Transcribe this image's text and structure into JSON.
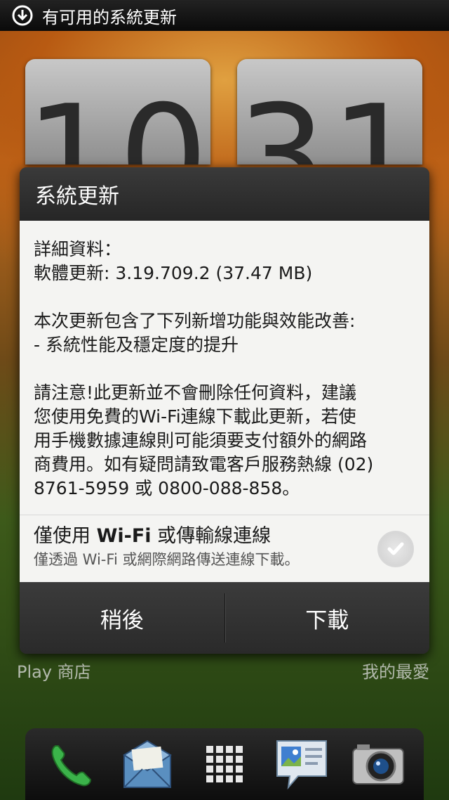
{
  "status_bar": {
    "notification_text": "有可用的系統更新"
  },
  "clock": {
    "hour": "10",
    "minute": "31"
  },
  "dialog": {
    "title": "系統更新",
    "details_heading": "詳細資料：",
    "software_update": "軟體更新: 3.19.709.2 (37.47 MB)",
    "includes_line": "本次更新包含了下列新增功能與效能改善:",
    "feature_line": "- 系統性能及穩定度的提升",
    "notice_lines": [
      "請注意!此更新並不會刪除任何資料，建議",
      "您使用免費的Wi-Fi連線下載此更新，若使",
      "用手機數據連線則可能須要支付額外的網路",
      "商費用。如有疑問請致電客戶服務熱線 (02)",
      "8761-5959 或 0800-088-858。"
    ],
    "option": {
      "title_prefix": "僅使用 ",
      "title_bold": "Wi-Fi",
      "title_suffix": " 或傳輸線連線",
      "subtitle": "僅透過 Wi-Fi 或網際網路傳送連線下載。",
      "checked": true
    },
    "buttons": {
      "later": "稍後",
      "download": "下載"
    }
  },
  "home": {
    "left_label": "Play 商店",
    "right_label": "我的最愛"
  },
  "dock": {
    "icons": [
      "phone-icon",
      "mail-icon",
      "app-grid-icon",
      "gallery-messages-icon",
      "camera-icon"
    ]
  }
}
